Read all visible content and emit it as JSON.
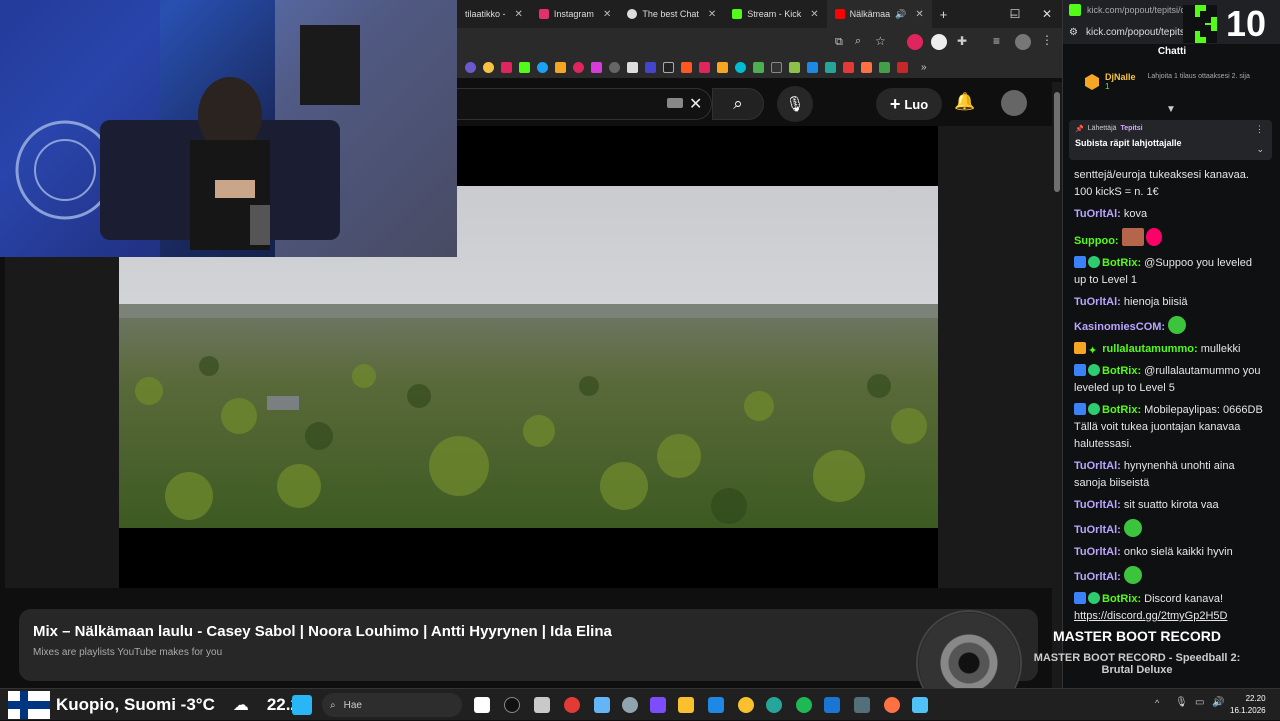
{
  "browser": {
    "tabs": [
      {
        "label": "tilaatikko -",
        "color": "#888888"
      },
      {
        "label": "Instagram",
        "color": "#e1306c"
      },
      {
        "label": "The best Chat",
        "color": "#dddddd"
      },
      {
        "label": "Stream - Kick",
        "color": "#53fc18"
      },
      {
        "label": "Nälkämaa",
        "color": "#ff0000"
      }
    ],
    "new_tab": "+",
    "window_controls": {
      "minimize": "–",
      "maximize": "☐",
      "close": "✕"
    }
  },
  "youtube": {
    "create_label": "Luo",
    "playlist": {
      "title": "Mix – Nälkämaan laulu - Casey Sabol | Noora Louhimo | Antti Hyyrynen | Ida Elina",
      "subtitle": "Mixes are playlists YouTube makes for you"
    }
  },
  "chat": {
    "url": "kick.com/popout/tepitsi/ch...",
    "short_url": "kick.com/popout/tepits",
    "heading": "Chatti",
    "kick_count": "10",
    "gifter": {
      "name": "DjNalle",
      "count": "1",
      "hint": "Lahjoita 1 tilaus ottaaksesi 2. sija"
    },
    "pinned": {
      "sender_label": "Lähettäjä",
      "sender": "Tepitsi",
      "text": "Subista räpit lahjottajalle"
    },
    "messages": [
      {
        "user": "",
        "text": "senttejä/euroja tukeaksesi kanavaa. 100 kickS = n. 1€",
        "color": "#ffffff"
      },
      {
        "user": "TuOrltAl:",
        "text": " kova",
        "color": "#b9a6ff"
      },
      {
        "user": "Suppoo:",
        "text": "",
        "color": "#53fc18"
      },
      {
        "user": "BotRix:",
        "text": " @Suppoo you leveled up to Level 1",
        "color": "#53fc18"
      },
      {
        "user": "TuOrltAl:",
        "text": " hienoja biisiä",
        "color": "#b9a6ff"
      },
      {
        "user": "KasinomiesCOM:",
        "text": "",
        "color": "#b9a6ff"
      },
      {
        "user": "rullalautamummo:",
        "text": " mullekki",
        "color": "#53fc18"
      },
      {
        "user": "BotRix:",
        "text": " @rullalautamummo you leveled up to Level 5",
        "color": "#53fc18"
      },
      {
        "user": "BotRix:",
        "text": " Mobilepaylipas: 0666DB Tällä voit tukea juontajan kanavaa halutessasi.",
        "color": "#53fc18"
      },
      {
        "user": "TuOrltAl:",
        "text": " hynynenhä unohti aina sanoja biiseistä",
        "color": "#b9a6ff"
      },
      {
        "user": "TuOrltAl:",
        "text": " sit suatto kirota vaa",
        "color": "#b9a6ff"
      },
      {
        "user": "TuOrltAl:",
        "text": "",
        "color": "#b9a6ff"
      },
      {
        "user": "TuOrltAl:",
        "text": " onko sielä kaikki hyvin",
        "color": "#b9a6ff"
      },
      {
        "user": "TuOrltAl:",
        "text": "",
        "color": "#b9a6ff"
      },
      {
        "user": "BotRix:",
        "text": " Discord kanava!",
        "color": "#53fc18"
      }
    ],
    "discord_link": "https://discord.gg/2tmyGp2H5D"
  },
  "now_playing": {
    "artist": "MASTER BOOT RECORD",
    "track": "MASTER BOOT RECORD - Speedball 2: Brutal Deluxe"
  },
  "taskbar": {
    "weather": "Kuopio, Suomi -3°C",
    "overlay_time": "22.20",
    "search_placeholder": "Hae",
    "time": "22.20",
    "date": "16.1.2026"
  }
}
